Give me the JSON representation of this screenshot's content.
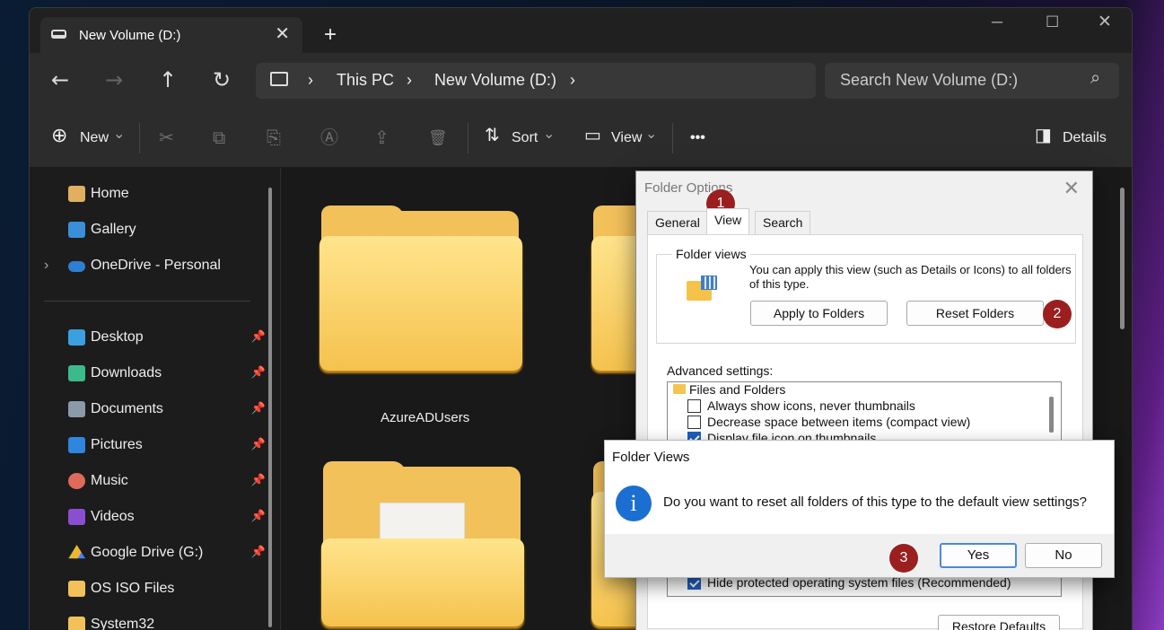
{
  "window": {
    "tab_title": "New Volume (D:)",
    "tab_close": "✕",
    "new_tab": "+",
    "minimize": "─",
    "maximize": "☐",
    "close": "✕"
  },
  "address": {
    "back": "←",
    "forward": "→",
    "up": "↑",
    "refresh": "↻",
    "computer_icon": "computer-icon",
    "sep": "›",
    "crumb1": "This PC",
    "crumb2": "New Volume (D:)",
    "search_placeholder": "Search New Volume (D:)",
    "search_icon": "⌕"
  },
  "toolbar": {
    "new_label": "New",
    "sort_label": "Sort",
    "view_label": "View",
    "more": "•••",
    "details_label": "Details",
    "caret": "⌄",
    "plus_circle": "⊕",
    "cut": "✂",
    "copy": "⧉",
    "paste": "⎘",
    "rename": "Ⓐ",
    "share": "⇪",
    "delete": "🗑",
    "sort_icon": "⇅",
    "view_icon": "▭",
    "details_icon": "◨"
  },
  "sidebar": {
    "items": [
      {
        "label": "Home",
        "icon": "home-icon",
        "color": "#e0b060"
      },
      {
        "label": "Gallery",
        "icon": "gallery-icon",
        "color": "#3a8fd8"
      },
      {
        "label": "OneDrive - Personal",
        "icon": "onedrive-icon",
        "color": "#2f7fd0"
      },
      {
        "label": "Desktop",
        "icon": "desktop-icon",
        "color": "#3ba0e0"
      },
      {
        "label": "Downloads",
        "icon": "downloads-icon",
        "color": "#3cba8c"
      },
      {
        "label": "Documents",
        "icon": "documents-icon",
        "color": "#8a9aa8"
      },
      {
        "label": "Pictures",
        "icon": "pictures-icon",
        "color": "#2e86de"
      },
      {
        "label": "Music",
        "icon": "music-icon",
        "color": "#e06a5a"
      },
      {
        "label": "Videos",
        "icon": "videos-icon",
        "color": "#8a4fd0"
      },
      {
        "label": "Google Drive (G:)",
        "icon": "google-drive-icon",
        "color": "#f2b530"
      },
      {
        "label": "OS ISO Files",
        "icon": "folder-icon",
        "color": "#f2c15a"
      },
      {
        "label": "System32",
        "icon": "folder-icon",
        "color": "#f2c15a"
      }
    ],
    "chevron": "›",
    "pin": "📌"
  },
  "content": {
    "folder1_label": "AzureADUsers"
  },
  "folder_options": {
    "title": "Folder Options",
    "close": "✕",
    "tabs": [
      "General",
      "View",
      "Search"
    ],
    "folder_views_label": "Folder views",
    "folder_views_text": "You can apply this view (such as Details or Icons) to all folders of this type.",
    "apply_button": "Apply to Folders",
    "reset_button": "Reset Folders",
    "advanced_label": "Advanced settings:",
    "tree_root": "Files and Folders",
    "settings": [
      {
        "label": "Always show icons, never thumbnails",
        "checked": false
      },
      {
        "label": "Decrease space between items (compact view)",
        "checked": false
      },
      {
        "label": "Display file icon on thumbnails",
        "checked": true
      },
      {
        "label": "Hide protected operating system files (Recommended)",
        "checked": true
      }
    ],
    "restore_button": "Restore Defaults"
  },
  "folder_views_dialog": {
    "title": "Folder Views",
    "icon": "i",
    "message": "Do you want to reset all folders of this type to the default view settings?",
    "yes": "Yes",
    "no": "No"
  },
  "markers": [
    "1",
    "2",
    "3"
  ]
}
